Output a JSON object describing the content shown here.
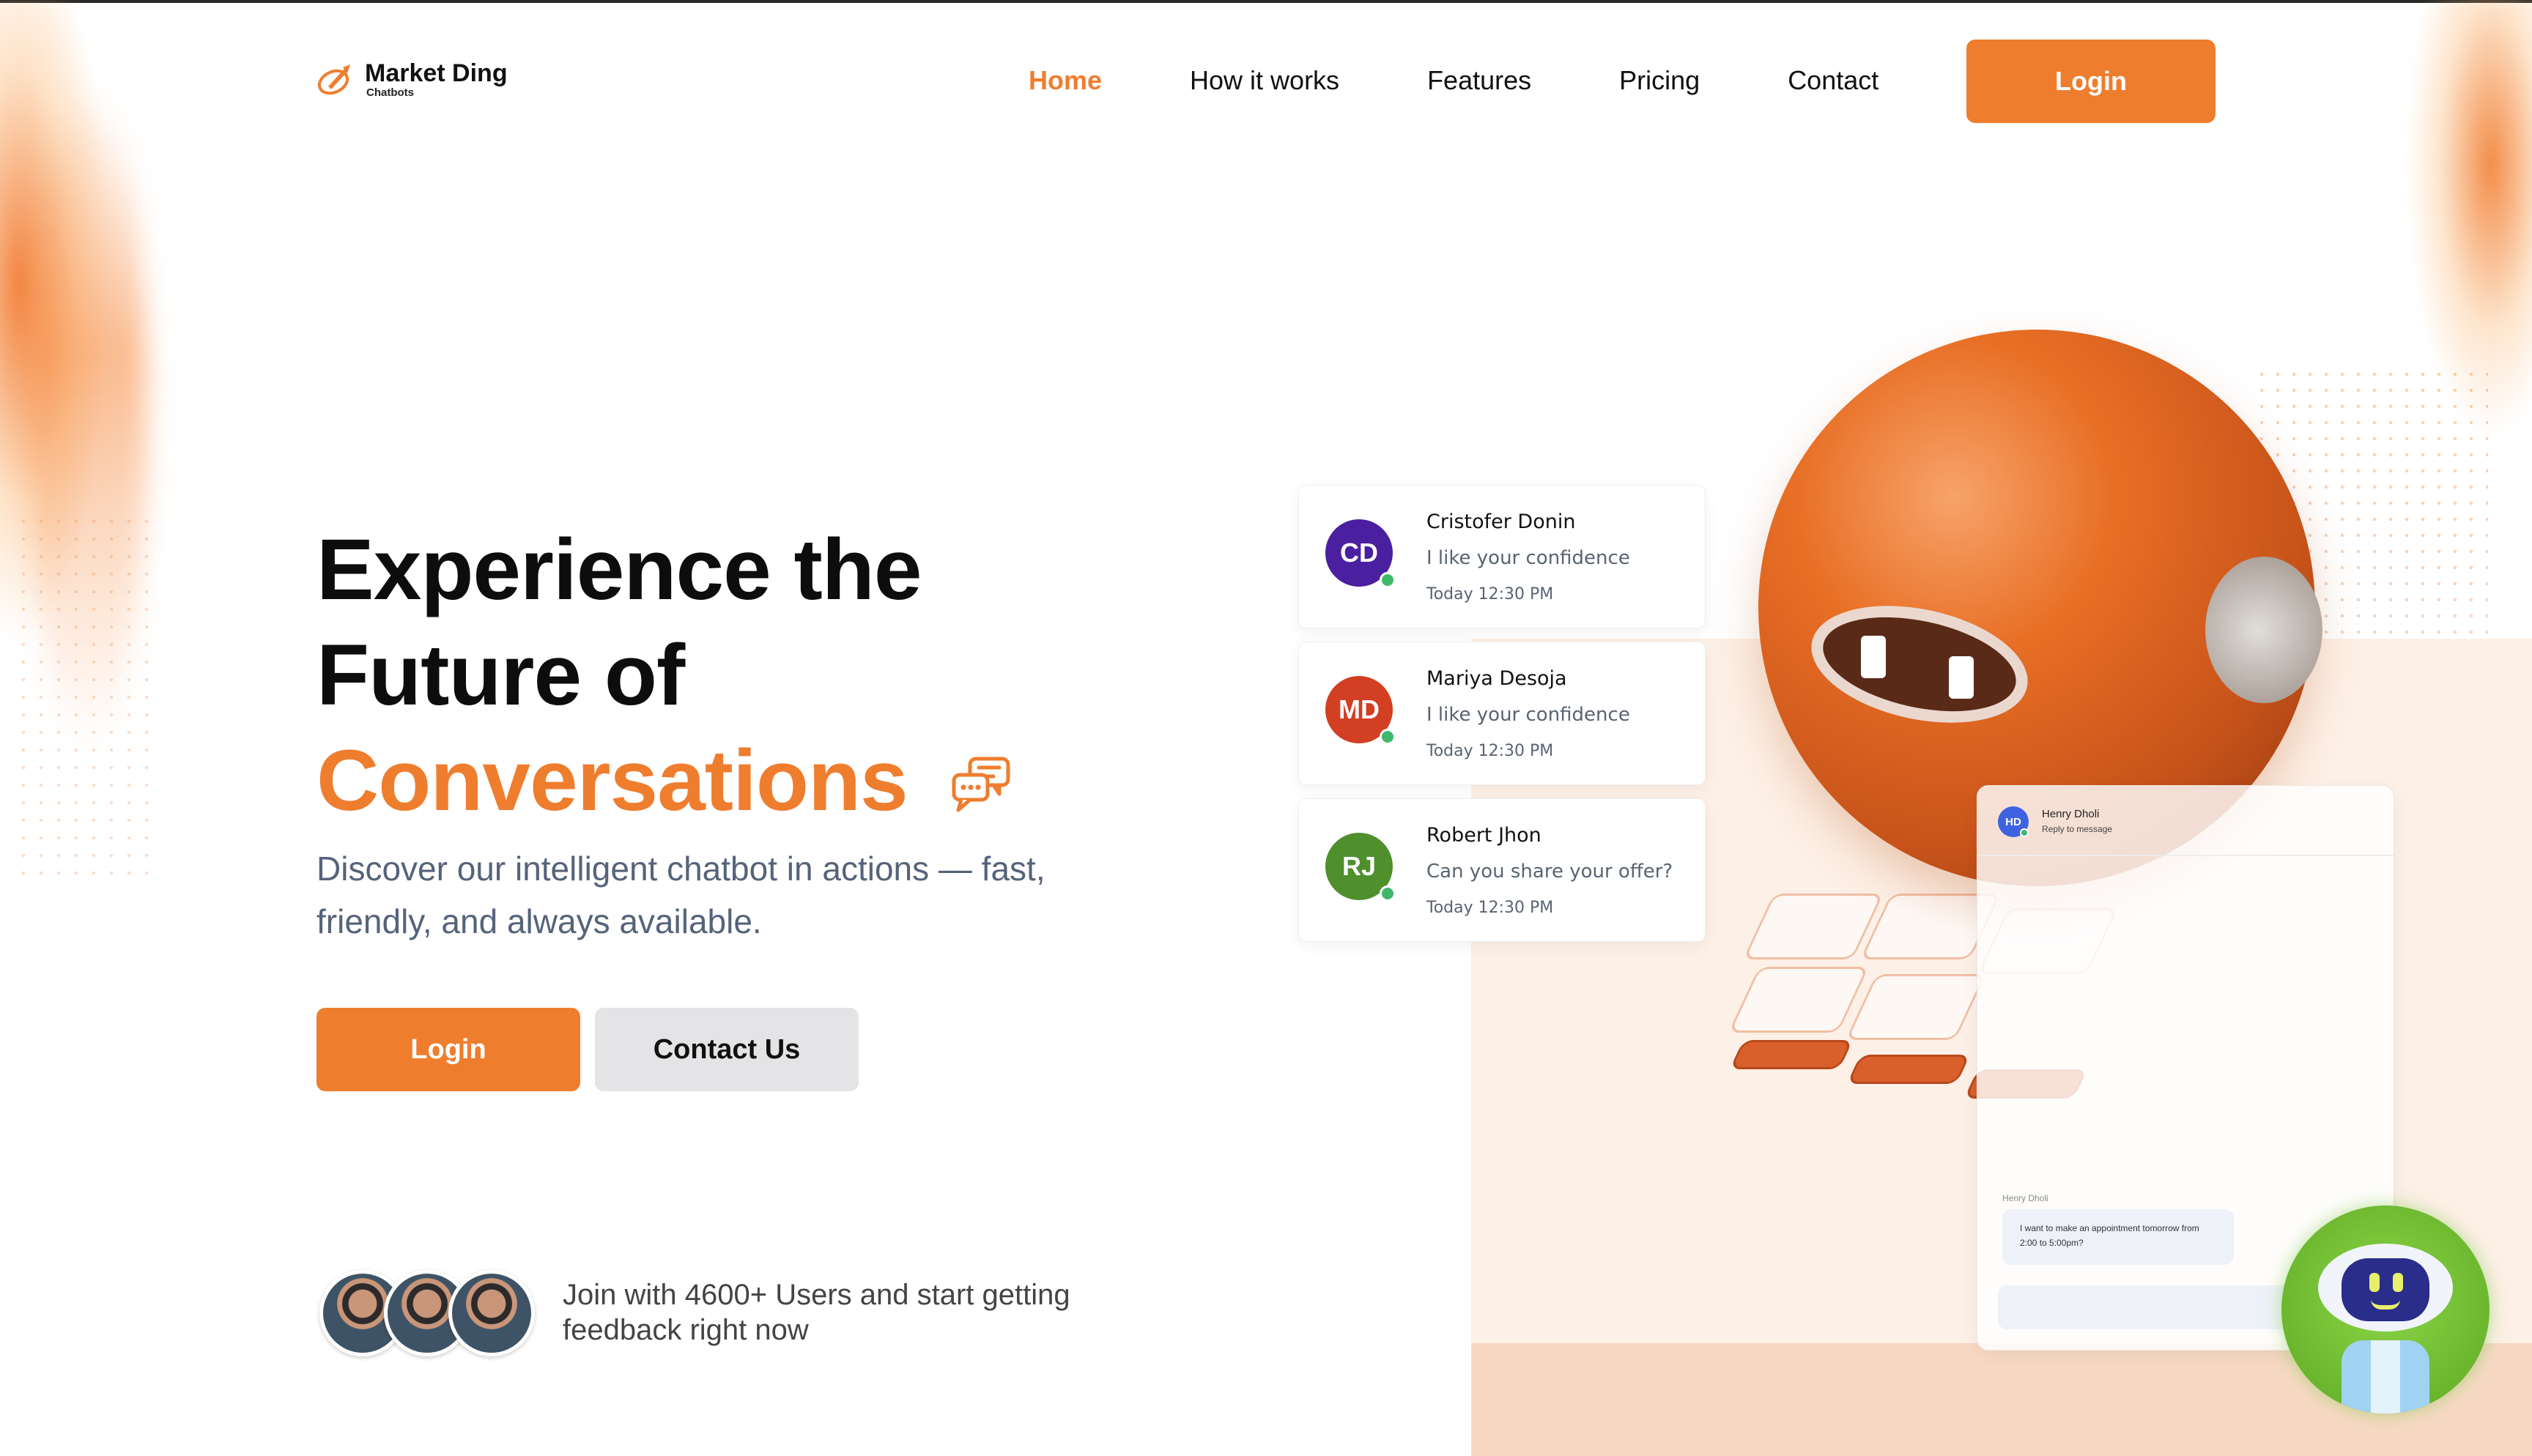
{
  "brand": {
    "name": "Market Ding",
    "tagline": "Chatbots",
    "accent": "#ef7d2e"
  },
  "nav": {
    "items": [
      {
        "label": "Home",
        "active": true
      },
      {
        "label": "How it works",
        "active": false
      },
      {
        "label": "Features",
        "active": false
      },
      {
        "label": "Pricing",
        "active": false
      },
      {
        "label": "Contact",
        "active": false
      }
    ],
    "login_label": "Login"
  },
  "hero": {
    "title_line1": "Experience the",
    "title_line2": "Future of",
    "title_accent": "Conversations",
    "subtitle": "Discover our intelligent chatbot in actions — fast, friendly, and always available.",
    "login_label": "Login",
    "contact_label": "Contact Us"
  },
  "social_proof": {
    "text": "Join with 4600+ Users and start getting feedback right now"
  },
  "messages": [
    {
      "initials": "CD",
      "name": "Cristofer Donin",
      "text": "I like your confidence",
      "time": "Today 12:30 PM",
      "color": "#4a1fa0"
    },
    {
      "initials": "MD",
      "name": "Mariya Desoja",
      "text": "I like your confidence",
      "time": "Today 12:30 PM",
      "color": "#d23f22"
    },
    {
      "initials": "RJ",
      "name": "Robert Jhon",
      "text": "Can you share your offer?",
      "time": "Today 12:30 PM",
      "color": "#4f8f2c"
    }
  ],
  "chat_window": {
    "initials": "HD",
    "name": "Henry Dholi",
    "status": "Reply to message",
    "sender": "Henry Dholi",
    "message": "I want to make an appointment tomorrow from 2:00 to 5:00pm?"
  },
  "icons": {
    "logo": "rocket-circle-icon",
    "conversation": "chat-bubbles-icon",
    "chatbot": "robot-icon"
  }
}
